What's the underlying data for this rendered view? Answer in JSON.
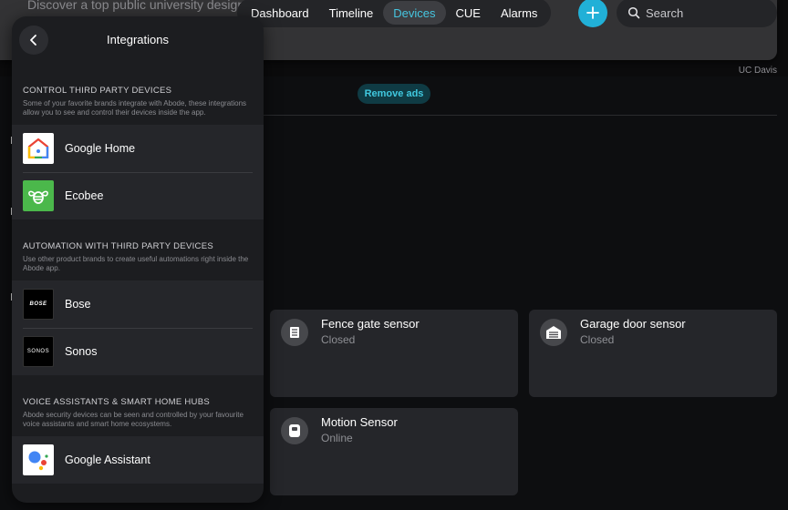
{
  "ad": {
    "text": "Discover a top public university designed to",
    "source": "UC Davis",
    "remove_ads": "Remove ads"
  },
  "nav": {
    "tabs": [
      {
        "label": "Dashboard",
        "active": false
      },
      {
        "label": "Timeline",
        "active": false
      },
      {
        "label": "Devices",
        "active": true
      },
      {
        "label": "CUE",
        "active": false
      },
      {
        "label": "Alarms",
        "active": false
      }
    ],
    "add_icon": "plus-icon",
    "search_placeholder": "Search"
  },
  "devices": [
    {
      "name": "Fence gate sensor",
      "status": "Closed",
      "icon": "door-sensor-icon"
    },
    {
      "name": "Garage door sensor",
      "status": "Closed",
      "icon": "garage-icon"
    },
    {
      "name": "Motion Sensor",
      "status": "Online",
      "icon": "motion-sensor-icon"
    }
  ],
  "integrations": {
    "title": "Integrations",
    "sections": [
      {
        "title": "CONTROL THIRD PARTY DEVICES",
        "description": "Some of your favorite brands integrate with Abode, these integrations allow you to see and control their devices inside the app.",
        "items": [
          {
            "label": "Google Home",
            "logo": "google-home-logo"
          },
          {
            "label": "Ecobee",
            "logo": "ecobee-logo"
          }
        ]
      },
      {
        "title": "AUTOMATION WITH THIRD PARTY DEVICES",
        "description": "Use other product brands to create useful automations right inside the Abode app.",
        "items": [
          {
            "label": "Bose",
            "logo": "bose-logo",
            "logo_text": "BOSE"
          },
          {
            "label": "Sonos",
            "logo": "sonos-logo",
            "logo_text": "SONOS"
          }
        ]
      },
      {
        "title": "VOICE ASSISTANTS & SMART HOME HUBS",
        "description": "Abode security devices can be seen and controlled by your favourite voice assistants and smart home ecosystems.",
        "items": [
          {
            "label": "Google Assistant",
            "logo": "google-assistant-logo"
          }
        ]
      }
    ]
  },
  "colors": {
    "accent": "#21b0d7",
    "active_tab_text": "#46c6e0",
    "panel_bg": "#1c1d20",
    "card_bg": "#25262a"
  }
}
